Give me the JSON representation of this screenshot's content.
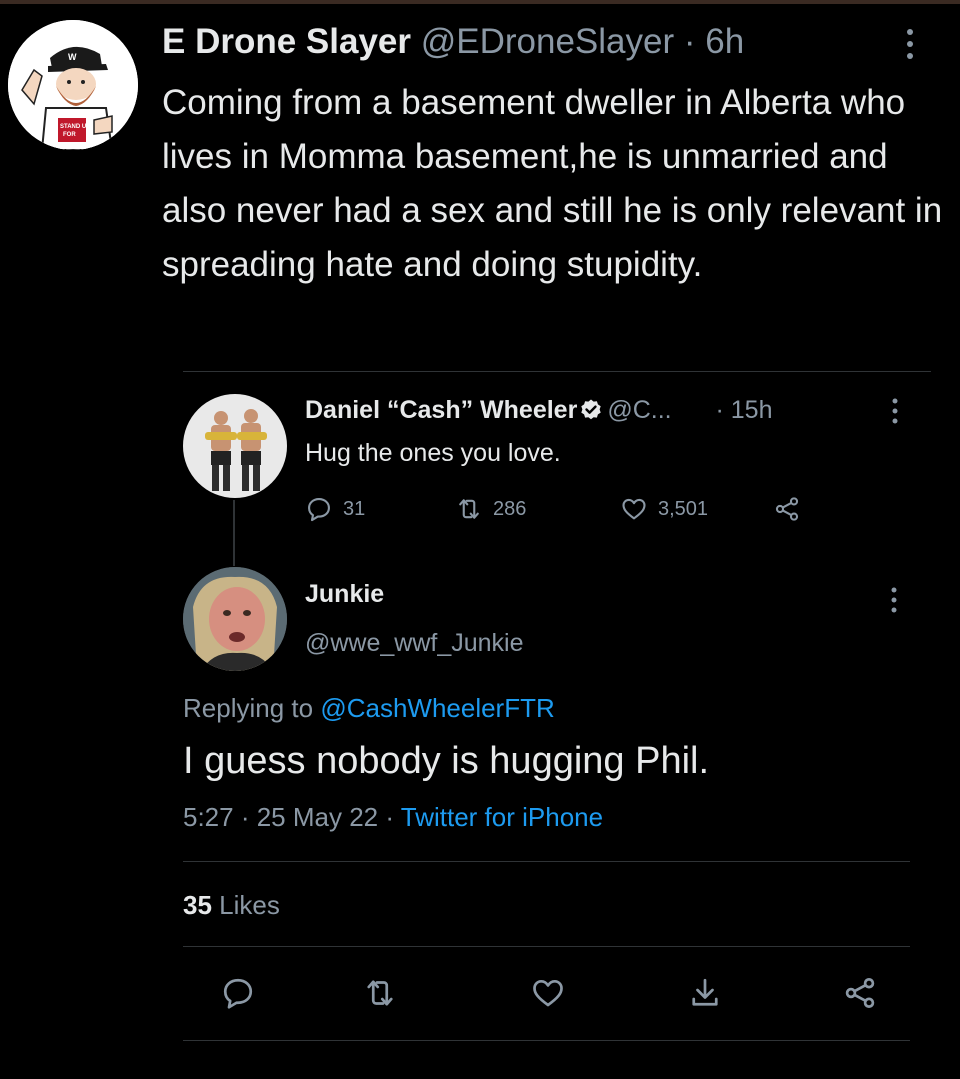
{
  "tweet": {
    "author_name": "E Drone Slayer",
    "handle": "@EDroneSlayer",
    "separator": "·",
    "time": "6h",
    "text": "Coming from a basement dweller in Alberta who lives in Momma basement,he is unmarried and also never had a sex and still he is only relevant in spreading hate and doing stupidity.",
    "avatar_shirt_text": "STAND UP FOR",
    "menu_icon": "more-vertical-icon"
  },
  "quoted": {
    "author_name": "Daniel “Cash” Wheeler",
    "handle": "@C...",
    "separator": "·",
    "time": "15h",
    "text": "Hug the ones you love.",
    "replies": "31",
    "retweets": "286",
    "likes": "3,501",
    "verified_icon": "verified-badge-icon"
  },
  "reply": {
    "author_name": "Junkie",
    "handle": "@wwe_wwf_Junkie",
    "replying_prefix": "Replying to",
    "replying_to": "@CashWheelerFTR",
    "text": "I guess nobody is hugging Phil.",
    "timestamp": "5:27 · 25 May 22 ·",
    "client": "Twitter for iPhone",
    "likes_count": "35",
    "likes_label": "Likes"
  },
  "actions": [
    "reply-icon",
    "retweet-icon",
    "like-icon",
    "share-icon",
    "share-nodes-icon"
  ],
  "colors": {
    "background": "#000000",
    "text": "#e7e9ea",
    "muted": "#8b98a5",
    "accent": "#1d9bf0",
    "divider": "#2f3336"
  }
}
